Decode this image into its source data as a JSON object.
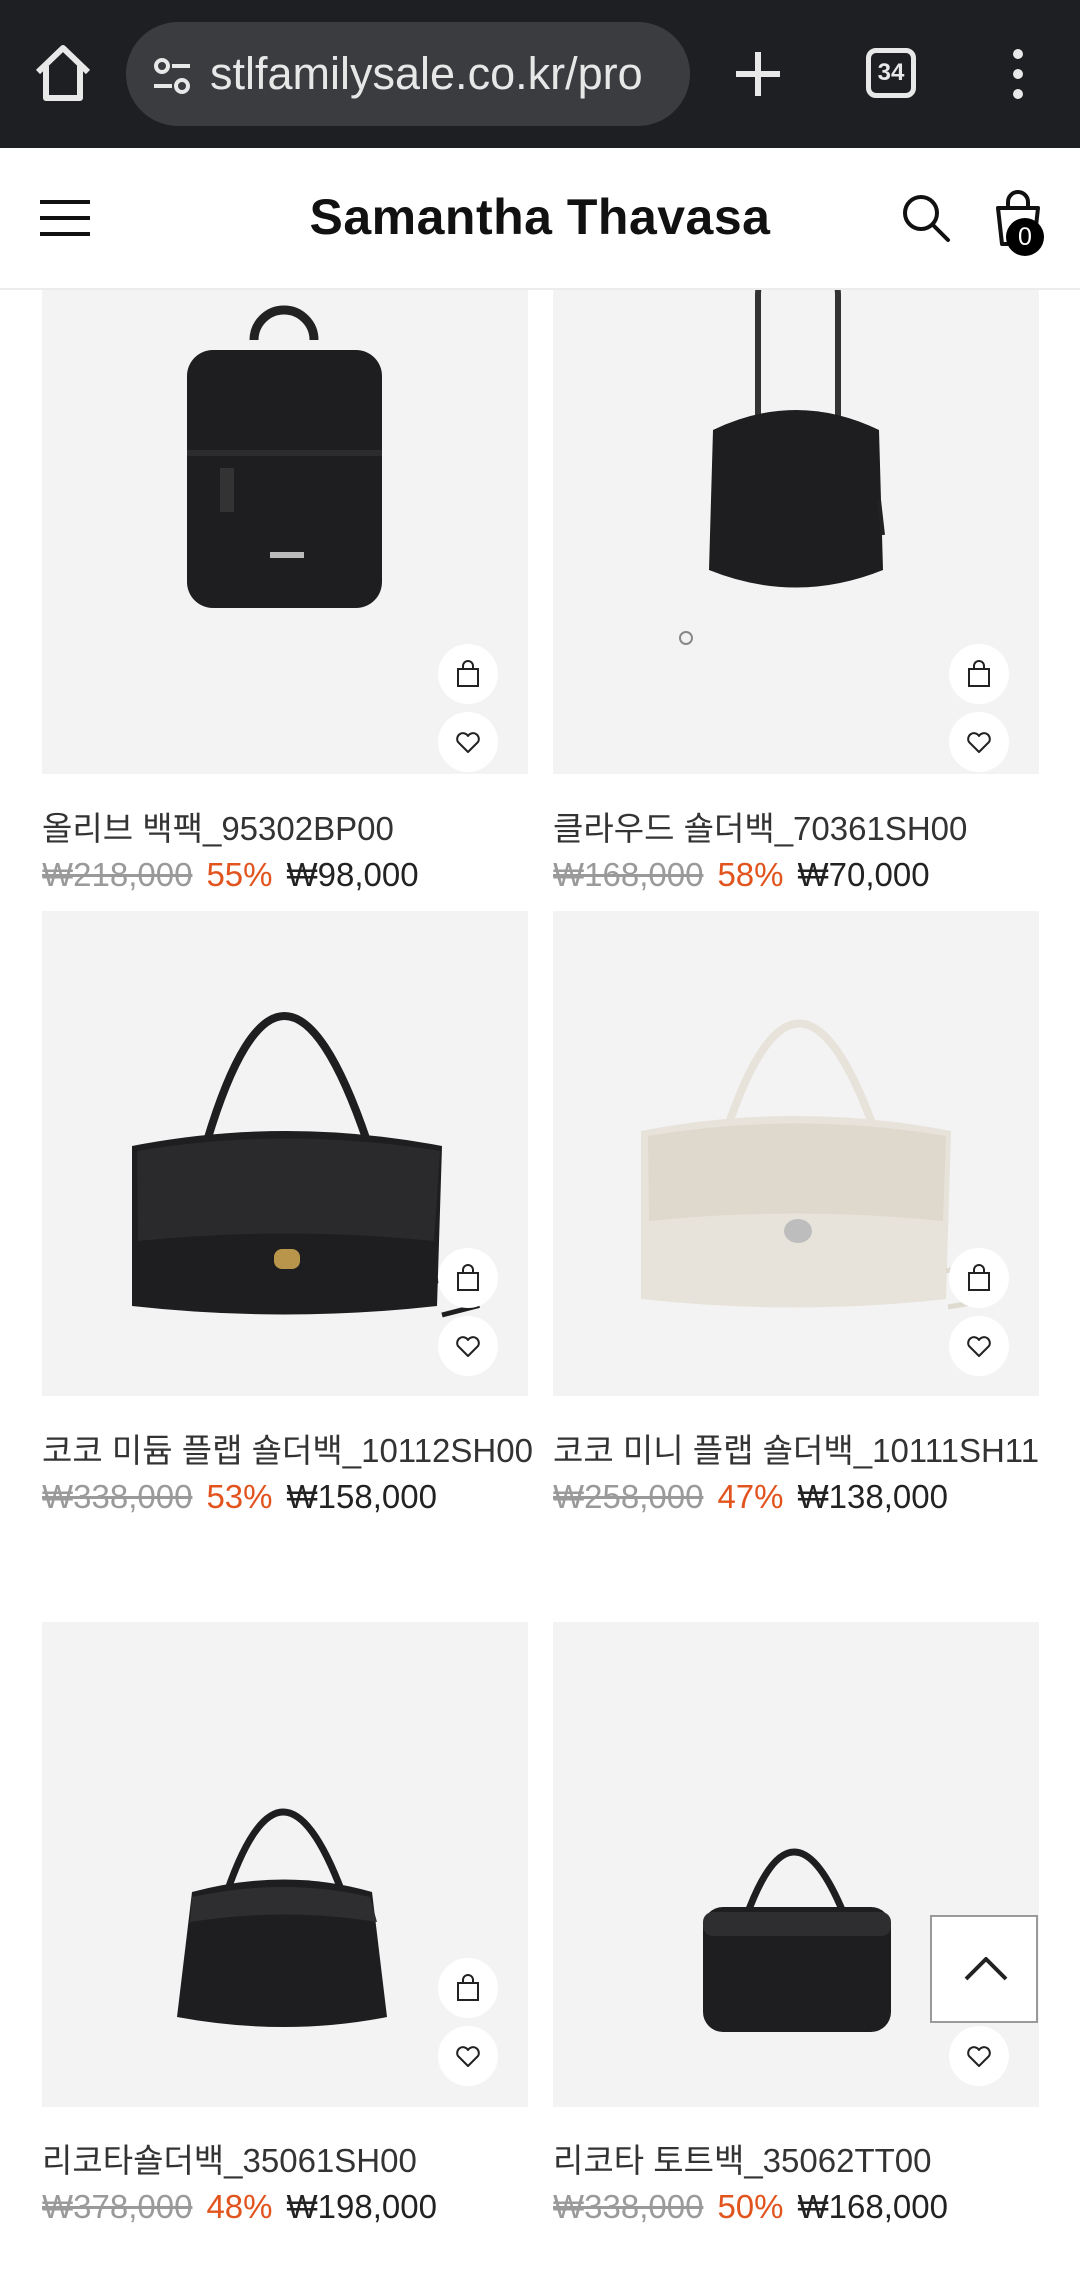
{
  "browser": {
    "url": "stlfamilysale.co.kr/pro",
    "tab_count": "34"
  },
  "site": {
    "brand": "Samantha Thavasa",
    "cart_count": "0"
  },
  "products": [
    {
      "name": "올리브 백팩_95302BP00",
      "original_price": "₩218,000",
      "discount": "55%",
      "sale_price": "₩98,000",
      "color": "black",
      "style": "backpack"
    },
    {
      "name": "클라우드 숄더백_70361SH00",
      "original_price": "₩168,000",
      "discount": "58%",
      "sale_price": "₩70,000",
      "color": "black",
      "style": "bucket"
    },
    {
      "name": "코코 미듐 플랩 숄더백_10112SH00",
      "original_price": "₩338,000",
      "discount": "53%",
      "sale_price": "₩158,000",
      "color": "black",
      "style": "flap"
    },
    {
      "name": "코코 미니 플랩 숄더백_10111SH11",
      "original_price": "₩258,000",
      "discount": "47%",
      "sale_price": "₩138,000",
      "color": "ivory",
      "style": "flap"
    },
    {
      "name": "리코타숄더백_35061SH00",
      "original_price": "₩378,000",
      "discount": "48%",
      "sale_price": "₩198,000",
      "color": "black",
      "style": "hobo"
    },
    {
      "name": "리코타 토트백_35062TT00",
      "original_price": "₩338,000",
      "discount": "50%",
      "sale_price": "₩168,000",
      "color": "black",
      "style": "tote"
    }
  ],
  "colors": {
    "discount": "#e2541e",
    "original_price": "#9a9a9a",
    "chrome_bg": "#1d1f22",
    "image_bg": "#f3f3f3"
  },
  "icons": [
    "home-icon",
    "site-settings-icon",
    "new-tab-icon",
    "tab-switcher-icon",
    "more-menu-icon",
    "hamburger-menu-icon",
    "search-icon",
    "cart-icon",
    "add-to-cart-icon",
    "wishlist-heart-icon",
    "scroll-to-top-icon"
  ]
}
